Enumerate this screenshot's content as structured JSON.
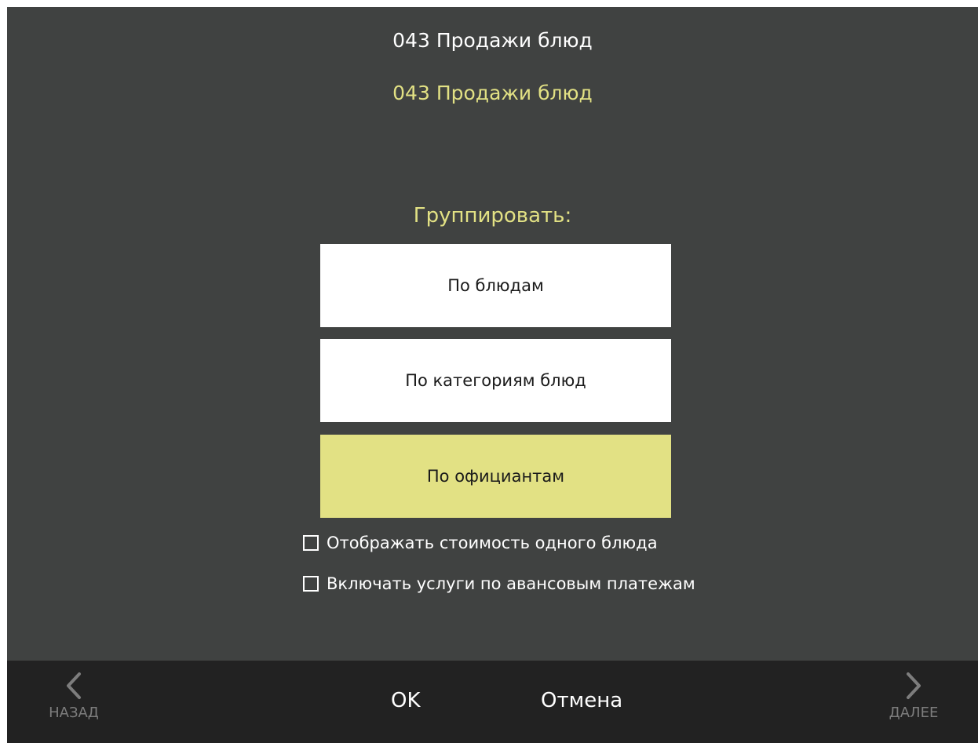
{
  "header": {
    "title": "043 Продажи блюд",
    "subtitle": "043 Продажи блюд"
  },
  "grouping": {
    "label": "Группировать:",
    "options": [
      {
        "label": "По блюдам",
        "selected": false
      },
      {
        "label": "По категориям блюд",
        "selected": false
      },
      {
        "label": "По официантам",
        "selected": true
      }
    ]
  },
  "checkboxes": [
    {
      "label": "Отображать стоимость одного блюда",
      "checked": false
    },
    {
      "label": "Включать услуги по авансовым платежам",
      "checked": false
    }
  ],
  "footer": {
    "back_label": "НАЗАД",
    "ok_label": "OK",
    "cancel_label": "Отмена",
    "next_label": "ДАЛЕЕ"
  },
  "colors": {
    "background": "#404241",
    "accent": "#e2e184",
    "footer": "#222222",
    "disabled": "#7d7d7d"
  }
}
